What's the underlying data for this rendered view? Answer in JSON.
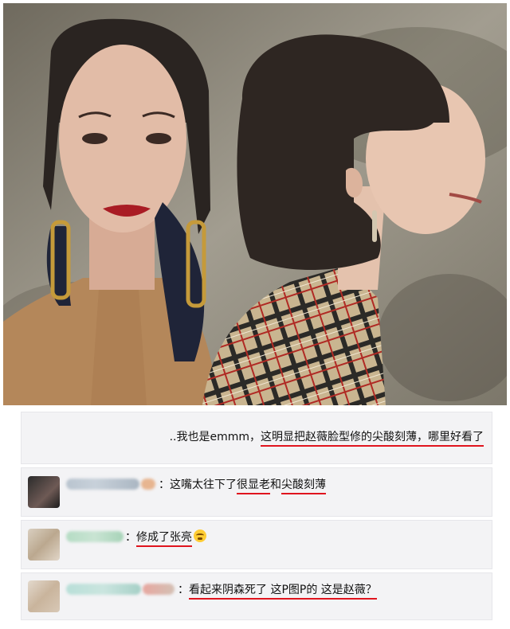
{
  "comments": [
    {
      "pre": "..我也是emmm，",
      "hl1": "这明显把赵薇脸型修的尖酸刻薄，哪里好看了"
    },
    {
      "pre": "：这嘴太往下了",
      "hl1": "很显老",
      "mid": "和",
      "hl2": "尖酸刻薄"
    },
    {
      "pre": "：",
      "hl1": "修成了张亮",
      "emoji": "crying-face-emoji"
    },
    {
      "pre": "：",
      "hl1": "看起来阴森死了 这P图P的 这是赵薇？"
    }
  ],
  "colors": {
    "underline": "#e0141e",
    "card_bg": "#f3f3f5"
  }
}
